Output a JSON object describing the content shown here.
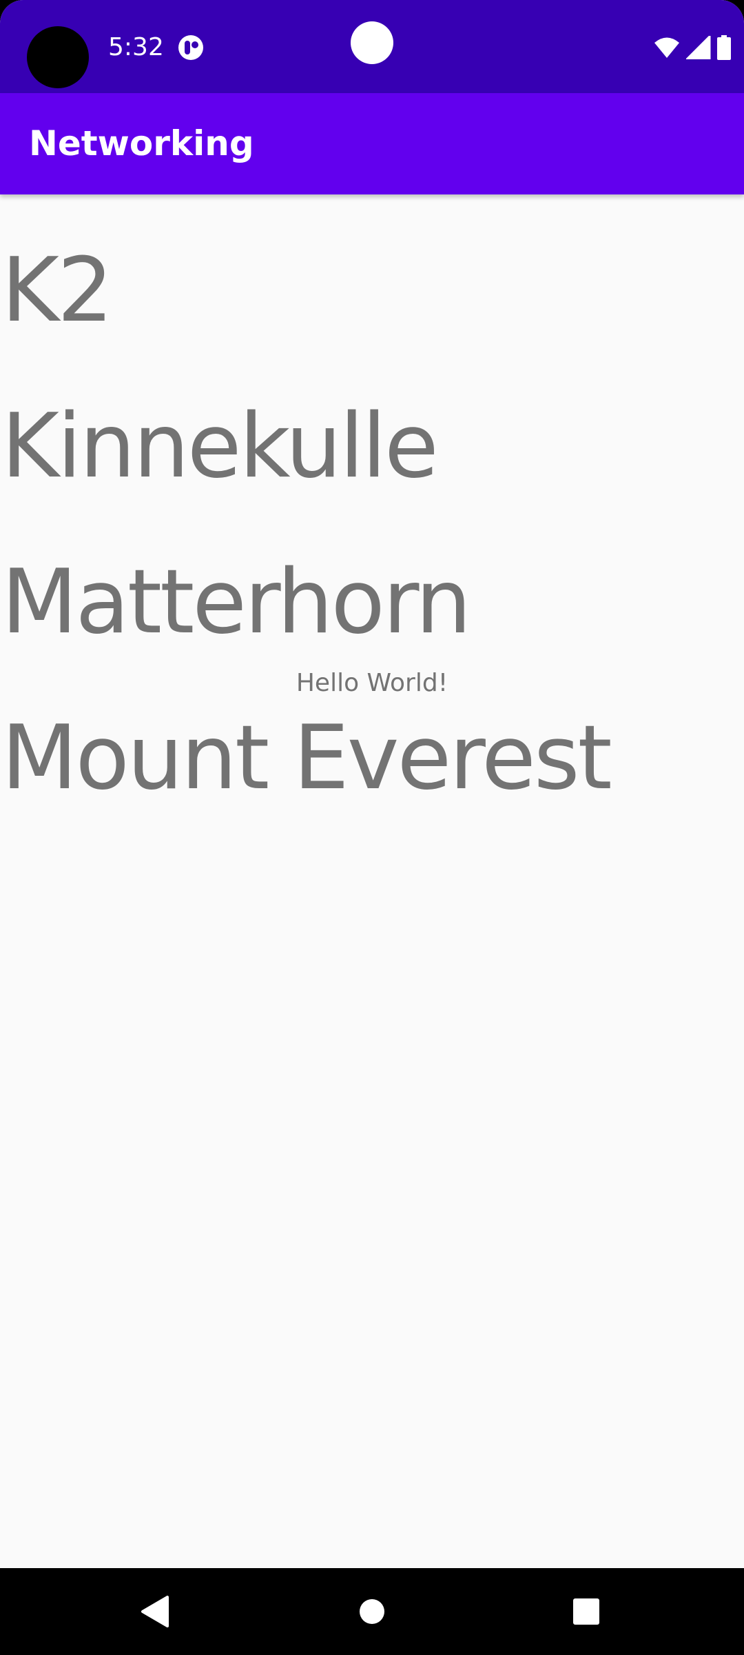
{
  "status_bar": {
    "time": "5:32",
    "icons": [
      "camera-cutout",
      "app-notification-icon",
      "center-dot",
      "wifi-icon",
      "cell-signal-icon",
      "battery-icon"
    ],
    "background_color": "#3700B3"
  },
  "app_bar": {
    "title": "Networking",
    "background_color": "#6200EE"
  },
  "main": {
    "mountains": [
      {
        "name": "K2"
      },
      {
        "name": "Kinnekulle"
      },
      {
        "name": "Matterhorn"
      },
      {
        "name": "Mount Everest"
      }
    ],
    "hello_text": "Hello World!",
    "text_color": "#737373",
    "background_color": "#FAFAFA"
  },
  "nav_bar": {
    "buttons": [
      "back-icon",
      "home-icon",
      "recents-icon"
    ]
  }
}
